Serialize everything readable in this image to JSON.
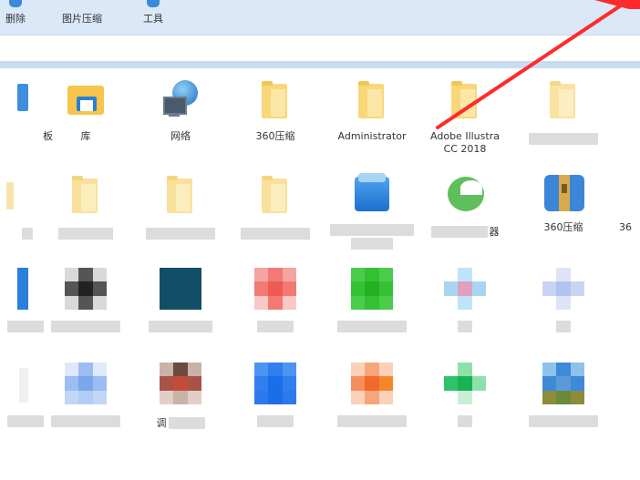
{
  "toolbar": {
    "buttons": [
      {
        "label": "删除"
      },
      {
        "label": "图片压缩"
      },
      {
        "label": "工具"
      }
    ]
  },
  "row1": [
    {
      "label": "板"
    },
    {
      "label": "库"
    },
    {
      "label": "网络"
    },
    {
      "label": "360压缩"
    },
    {
      "label": "Administrator"
    },
    {
      "label": "Adobe Illustra\nCC 2018"
    }
  ],
  "row2": [
    {
      "label": "器"
    },
    {
      "label": "360压缩"
    },
    {
      "label": "36"
    }
  ],
  "row4": [
    {
      "label": "调"
    }
  ],
  "colors": {
    "toolbar_bg": "#dbe8f7",
    "folder": "#f8d77a",
    "annotation_arrow": "#ff2a2a"
  }
}
